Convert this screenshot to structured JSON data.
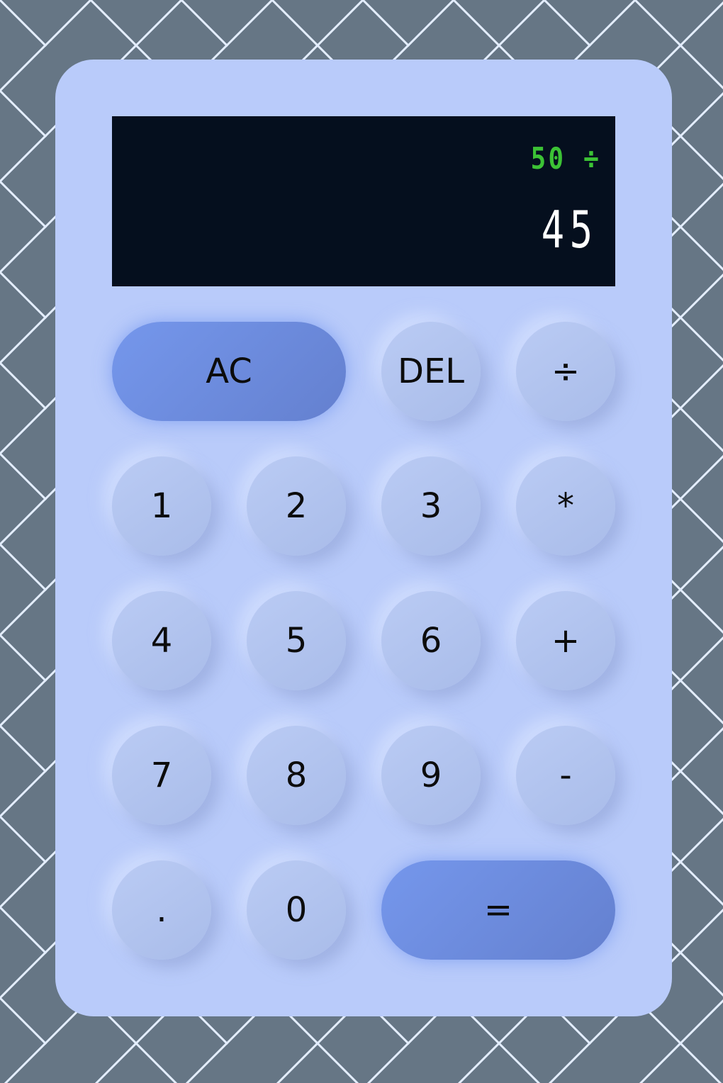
{
  "display": {
    "previous": "50 ÷",
    "current": "45"
  },
  "keys": {
    "ac": "AC",
    "del": "DEL",
    "divide": "÷",
    "one": "1",
    "two": "2",
    "three": "3",
    "multiply": "*",
    "four": "4",
    "five": "5",
    "six": "6",
    "plus": "+",
    "seven": "7",
    "eight": "8",
    "nine": "9",
    "minus": "-",
    "decimal": ".",
    "zero": "0",
    "equals": "="
  },
  "colors": {
    "background": "#667685",
    "pattern_lines": "#e4eeff",
    "body": "#b9cbfa",
    "display": "#050f1e",
    "previous_operand": "#3cc235",
    "current_operand": "#ffffff",
    "accent_key": "#6e8fe6"
  }
}
